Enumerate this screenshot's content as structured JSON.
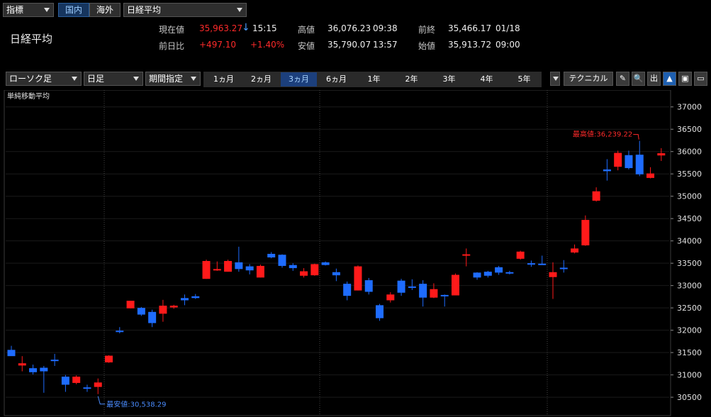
{
  "top": {
    "indicator_select": "指標",
    "tab_domestic": "国内",
    "tab_overseas": "海外",
    "symbol_select": "日経平均"
  },
  "quote": {
    "name": "日経平均",
    "current_label": "現在値",
    "current_value": "35,963.27",
    "current_arrow": "↓",
    "current_time": "15:15",
    "change_label": "前日比",
    "change_value": "+497.10",
    "change_pct": "+1.40%",
    "high_label": "高値",
    "high_value": "36,076.23",
    "high_time": "09:38",
    "low_label": "安値",
    "low_value": "35,790.07",
    "low_time": "13:57",
    "prev_label": "前終",
    "prev_value": "35,466.17",
    "prev_date": "01/18",
    "open_label": "始値",
    "open_value": "35,913.72",
    "open_time": "09:00"
  },
  "toolbar": {
    "chart_type": "ローソク足",
    "interval": "日足",
    "range_mode": "期間指定",
    "periods": [
      "1ヵ月",
      "2ヵ月",
      "3ヵ月",
      "6ヵ月",
      "1年",
      "2年",
      "3年",
      "4年",
      "5年"
    ],
    "active_period_index": 2,
    "technical_label": "テクニカル",
    "icons": [
      "pencil-icon",
      "zoom-icon",
      "output-icon",
      "chart-line-icon",
      "save-icon",
      "folder-icon"
    ],
    "icon_glyphs": [
      "✎",
      "🔍",
      "出",
      "▲",
      "▣",
      "▭"
    ]
  },
  "chart_data": {
    "type": "candlestick",
    "overlay_label": "単純移動平均",
    "y_ticks": [
      30500,
      31000,
      31500,
      32000,
      32500,
      33000,
      33500,
      34000,
      34500,
      35000,
      35500,
      36000,
      36500,
      37000
    ],
    "ylim": [
      30200,
      37250
    ],
    "up_color": "#ff1a1a",
    "down_color": "#1e6cff",
    "high_annotation": "最高値:36,239.22",
    "low_annotation": "最安値:30,538.29",
    "candles": [
      {
        "o": 31560,
        "h": 31650,
        "l": 31450,
        "c": 31420
      },
      {
        "o": 31210,
        "h": 31420,
        "l": 31080,
        "c": 31260
      },
      {
        "o": 31150,
        "h": 31230,
        "l": 31010,
        "c": 31060
      },
      {
        "o": 31160,
        "h": 31200,
        "l": 30600,
        "c": 31080
      },
      {
        "o": 31340,
        "h": 31470,
        "l": 31200,
        "c": 31310
      },
      {
        "o": 30960,
        "h": 31000,
        "l": 30620,
        "c": 30780
      },
      {
        "o": 30820,
        "h": 30990,
        "l": 30790,
        "c": 30960
      },
      {
        "o": 30720,
        "h": 30780,
        "l": 30620,
        "c": 30700
      },
      {
        "o": 30730,
        "h": 30920,
        "l": 30570,
        "c": 30830
      },
      {
        "o": 31280,
        "h": 31440,
        "l": 31270,
        "c": 31430
      },
      {
        "o": 31990,
        "h": 32070,
        "l": 31930,
        "c": 31980
      },
      {
        "o": 32490,
        "h": 32660,
        "l": 32490,
        "c": 32660
      },
      {
        "o": 32500,
        "h": 32520,
        "l": 32320,
        "c": 32350
      },
      {
        "o": 32410,
        "h": 32460,
        "l": 32070,
        "c": 32160
      },
      {
        "o": 32370,
        "h": 32680,
        "l": 32190,
        "c": 32550
      },
      {
        "o": 32510,
        "h": 32570,
        "l": 32480,
        "c": 32550
      },
      {
        "o": 32720,
        "h": 32800,
        "l": 32560,
        "c": 32670
      },
      {
        "o": 32760,
        "h": 32810,
        "l": 32700,
        "c": 32720
      },
      {
        "o": 33150,
        "h": 33580,
        "l": 33150,
        "c": 33550
      },
      {
        "o": 33340,
        "h": 33540,
        "l": 33330,
        "c": 33370
      },
      {
        "o": 33310,
        "h": 33580,
        "l": 33310,
        "c": 33550
      },
      {
        "o": 33520,
        "h": 33870,
        "l": 33310,
        "c": 33370
      },
      {
        "o": 33430,
        "h": 33480,
        "l": 33250,
        "c": 33340
      },
      {
        "o": 33180,
        "h": 33470,
        "l": 33180,
        "c": 33440
      },
      {
        "o": 33710,
        "h": 33750,
        "l": 33610,
        "c": 33630
      },
      {
        "o": 33690,
        "h": 33700,
        "l": 33400,
        "c": 33440
      },
      {
        "o": 33460,
        "h": 33500,
        "l": 33330,
        "c": 33390
      },
      {
        "o": 33220,
        "h": 33390,
        "l": 33180,
        "c": 33320
      },
      {
        "o": 33230,
        "h": 33490,
        "l": 33220,
        "c": 33480
      },
      {
        "o": 33520,
        "h": 33540,
        "l": 33450,
        "c": 33460
      },
      {
        "o": 33300,
        "h": 33380,
        "l": 33100,
        "c": 33230
      },
      {
        "o": 33040,
        "h": 33090,
        "l": 32670,
        "c": 32770
      },
      {
        "o": 32890,
        "h": 33450,
        "l": 32890,
        "c": 33430
      },
      {
        "o": 33120,
        "h": 33170,
        "l": 32800,
        "c": 32860
      },
      {
        "o": 32560,
        "h": 32590,
        "l": 32210,
        "c": 32270
      },
      {
        "o": 32670,
        "h": 32850,
        "l": 32620,
        "c": 32800
      },
      {
        "o": 33110,
        "h": 33150,
        "l": 32770,
        "c": 32840
      },
      {
        "o": 32980,
        "h": 33140,
        "l": 32900,
        "c": 32960
      },
      {
        "o": 33040,
        "h": 33120,
        "l": 32530,
        "c": 32730
      },
      {
        "o": 32730,
        "h": 33050,
        "l": 32720,
        "c": 32920
      },
      {
        "o": 32790,
        "h": 32800,
        "l": 32530,
        "c": 32780
      },
      {
        "o": 32780,
        "h": 33270,
        "l": 32780,
        "c": 33240
      },
      {
        "o": 33680,
        "h": 33830,
        "l": 33430,
        "c": 33700
      },
      {
        "o": 33290,
        "h": 33300,
        "l": 33130,
        "c": 33180
      },
      {
        "o": 33310,
        "h": 33330,
        "l": 33180,
        "c": 33220
      },
      {
        "o": 33410,
        "h": 33440,
        "l": 33240,
        "c": 33290
      },
      {
        "o": 33300,
        "h": 33330,
        "l": 33250,
        "c": 33290
      },
      {
        "o": 33600,
        "h": 33780,
        "l": 33580,
        "c": 33760
      },
      {
        "o": 33500,
        "h": 33560,
        "l": 33420,
        "c": 33470
      },
      {
        "o": 33490,
        "h": 33670,
        "l": 33470,
        "c": 33480
      },
      {
        "o": 33190,
        "h": 33520,
        "l": 32700,
        "c": 33300
      },
      {
        "o": 33400,
        "h": 33570,
        "l": 33290,
        "c": 33380
      },
      {
        "o": 33740,
        "h": 33920,
        "l": 33720,
        "c": 33830
      },
      {
        "o": 33900,
        "h": 34570,
        "l": 33890,
        "c": 34470
      },
      {
        "o": 34900,
        "h": 35200,
        "l": 34880,
        "c": 35110
      },
      {
        "o": 35600,
        "h": 35830,
        "l": 35350,
        "c": 35560
      },
      {
        "o": 35660,
        "h": 36020,
        "l": 35580,
        "c": 35970
      },
      {
        "o": 35920,
        "h": 36020,
        "l": 35600,
        "c": 35630
      },
      {
        "o": 35930,
        "h": 36239,
        "l": 35450,
        "c": 35490
      },
      {
        "o": 35410,
        "h": 35650,
        "l": 35400,
        "c": 35510
      },
      {
        "o": 35913,
        "h": 36076,
        "l": 35790,
        "c": 35963
      }
    ]
  }
}
